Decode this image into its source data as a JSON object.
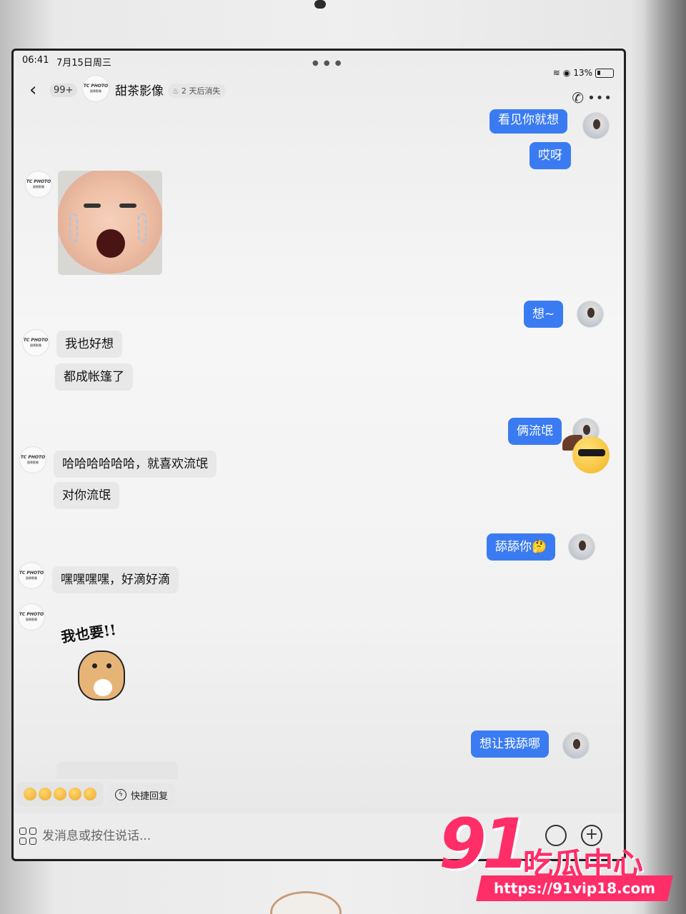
{
  "status": {
    "time": "06:41",
    "date": "7月15日周三",
    "battery": "13%",
    "wifi_icon": "wifi-icon",
    "signal_icon": "sync-icon"
  },
  "header": {
    "unread": "99+",
    "avatar_text": "TC PHOTO",
    "avatar_sub": "甜茶影像",
    "name": "甜茶影像",
    "disappear_label": "2 天后消失"
  },
  "messages": {
    "out_1": "看见你就想",
    "out_2": "哎呀",
    "out_3": "想~",
    "in_1": "我也好想",
    "in_2": "都成帐篷了",
    "out_4": "俩流氓",
    "in_3": "哈哈哈哈哈哈，就喜欢流氓",
    "in_4": "对你流氓",
    "out_5": "舔舔你🤔",
    "in_5": "嘿嘿嘿嘿，好滴好滴",
    "out_6": "想让我舔哪"
  },
  "stickers": {
    "cat_text": "我也要!!"
  },
  "quick_reply": {
    "label": "快捷回复"
  },
  "input": {
    "placeholder": "发消息或按住说话..."
  },
  "watermark": {
    "number": "91",
    "text": "吃瓜中心",
    "url": "https://91vip18.com"
  },
  "colors": {
    "outgoing_bubble": "#3a7bf2",
    "incoming_bubble": "#e8e8e8",
    "watermark": "#ff2d68"
  }
}
